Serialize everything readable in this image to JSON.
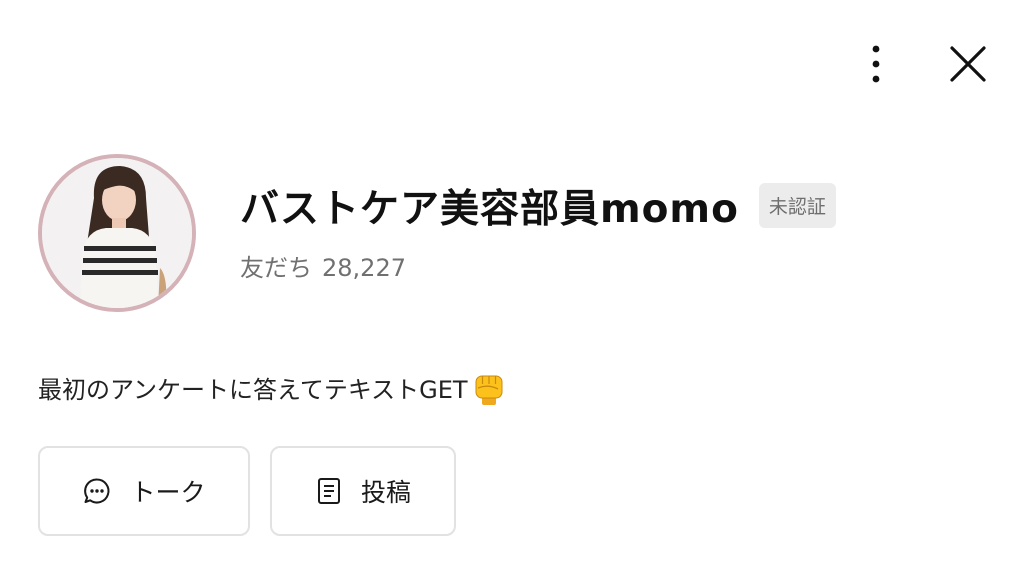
{
  "header": {
    "more_icon": "more-vertical-icon",
    "close_icon": "close-icon"
  },
  "profile": {
    "name": "バストケア美容部員momo",
    "verification_badge": "未認証",
    "friends_label": "友だち",
    "friends_count": "28,227",
    "avatar_border_color": "#d4b2b8"
  },
  "status_message": {
    "text": "最初のアンケートに答えてテキストGET",
    "emoji": "raised-fist-emoji"
  },
  "actions": [
    {
      "label": "トーク",
      "icon": "chat-bubble-icon"
    },
    {
      "label": "投稿",
      "icon": "document-icon"
    }
  ]
}
